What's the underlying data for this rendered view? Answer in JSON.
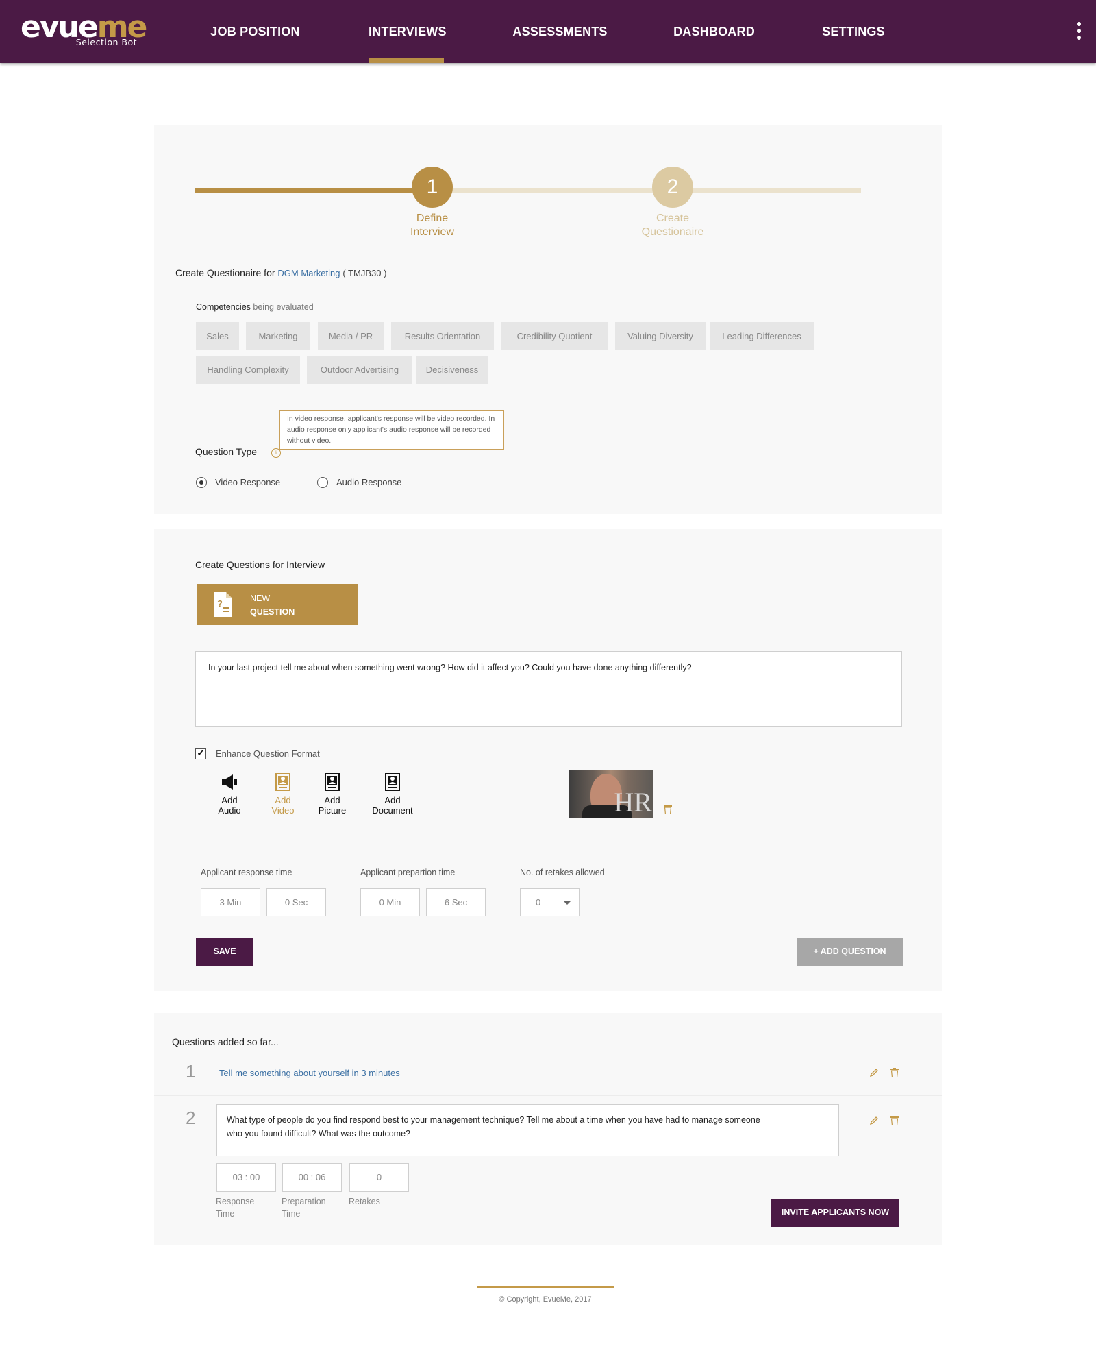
{
  "brand": {
    "logo_main": "evue",
    "logo_accent": "me",
    "tagline": "Selection Bot"
  },
  "nav": {
    "items": [
      {
        "label": "JOB POSITION"
      },
      {
        "label": "INTERVIEWS",
        "active": true
      },
      {
        "label": "ASSESSMENTS"
      },
      {
        "label": "DASHBOARD"
      },
      {
        "label": "SETTINGS"
      }
    ],
    "menu_icon": "kebab-menu-icon"
  },
  "stepper": {
    "steps": [
      {
        "number": "1",
        "label_line1": "Define",
        "label_line2": "Interview",
        "state": "active"
      },
      {
        "number": "2",
        "label_line1": "Create",
        "label_line2": "Questionaire",
        "state": "pending"
      }
    ]
  },
  "questionnaire": {
    "title_prefix": "Create Questionaire for",
    "position_link": "DGM Marketing",
    "position_code": "( TMJB30 )",
    "competencies_label": "Competencies",
    "competencies_sub": "being evaluated",
    "competencies": [
      "Sales",
      "Marketing",
      "Media / PR",
      "Results Orientation",
      "Credibility Quotient",
      "Valuing Diversity",
      "Leading Differences",
      "Handling Complexity",
      "Outdoor Advertising",
      "Decisiveness"
    ],
    "tooltip": "In video response, applicant's response will be video recorded. In audio response only applicant's audio response will be recorded without video.",
    "question_type_label": "Question Type",
    "info_icon": "info-icon",
    "options": {
      "video": "Video Response",
      "audio": "Audio Response",
      "selected": "video"
    }
  },
  "create_questions": {
    "title": "Create Questions for Interview",
    "new_question": {
      "line1": "NEW",
      "line2": "QUESTION",
      "icon": "question-document-icon"
    },
    "question_text": "In your last project tell me about when something went wrong? How did it affect you? Could you have done anything differently?",
    "enhance_label": "Enhance Question Format",
    "enhance_checked": true,
    "media_buttons": [
      {
        "line1": "Add",
        "line2": "Audio",
        "icon": "speaker-icon"
      },
      {
        "line1": "Add",
        "line2": "Video",
        "icon": "video-icon",
        "active": true
      },
      {
        "line1": "Add",
        "line2": "Picture",
        "icon": "picture-icon"
      },
      {
        "line1": "Add",
        "line2": "Document",
        "icon": "document-icon"
      }
    ],
    "thumbnail_text": "HR",
    "response_time_label": "Applicant response time",
    "response_min": "3  Min",
    "response_sec": "0 Sec",
    "prep_time_label": "Applicant prepartion time",
    "prep_min": "0  Min",
    "prep_sec": "6 Sec",
    "retakes_label": "No. of retakes allowed",
    "retakes_value": "0",
    "save_label": "SAVE",
    "add_label": "+ ADD QUESTION"
  },
  "questions_added": {
    "title": "Questions added so far...",
    "items": [
      {
        "number": "1",
        "text": "Tell me something about yourself in 3 minutes"
      },
      {
        "number": "2",
        "text_line1": "What type of people do you find respond best to your management technique? Tell me about a time when you have had to manage someone",
        "text_line2": "who you found difficult? What was the outcome?",
        "response_time": "03 : 00",
        "prep_time": "00 : 06",
        "retakes": "0",
        "response_label_1": "Response",
        "response_label_2": "Time",
        "prep_label_1": "Preparation",
        "prep_label_2": "Time",
        "retakes_label": "Retakes"
      }
    ],
    "invite_label": "INVITE APPLICANTS NOW"
  },
  "footer": {
    "copyright": "© Copyright, EvueMe, 2017"
  },
  "colors": {
    "nav_bg": "#4b1a45",
    "accent_gold": "#b88f45",
    "link_blue": "#3a6fa3"
  }
}
